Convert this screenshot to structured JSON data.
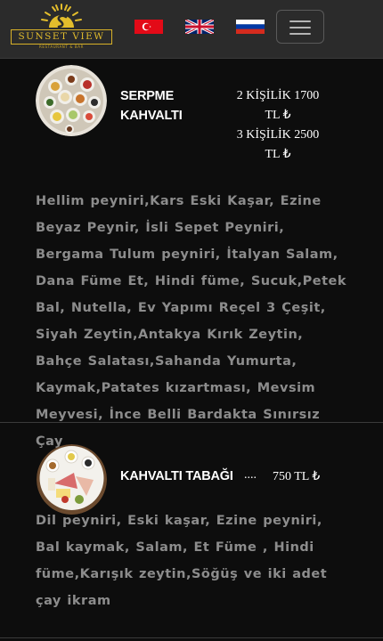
{
  "header": {
    "logo": {
      "title": "SUNSET VIEW",
      "subtitle": "RESTAURANT & BAR"
    },
    "languages": [
      {
        "name": "turkish-flag"
      },
      {
        "name": "english-flag"
      },
      {
        "name": "russian-flag"
      }
    ],
    "menu_icon": "hamburger-icon"
  },
  "colors": {
    "header_bg": "#2b2b2b",
    "page_bg": "#0d0d0d",
    "logo_gold": "#e3bd2c",
    "description_text": "#8c8c8c"
  },
  "items": [
    {
      "name_line1": "SERPME",
      "name_line2": "KAHVALTI",
      "price_line1": "2 KİŞİLİK 1700",
      "price_line2": "TL ₺",
      "price_line3": "3 KİŞİLİK 2500",
      "price_line4": "TL ₺",
      "description": "Hellim peyniri,Kars Eski Kaşar, Ezine Beyaz Peynir, İsli Sepet Peyniri, Bergama Tulum peyniri, İtalyan Salam, Dana Füme Et, Hindi füme, Sucuk,Petek Bal, Nutella, Ev Yapımı Reçel 3 Çeşit, Siyah Zeytin,Antakya Kırık Zeytin, Bahçe Salatası,Sahanda Yumurta, Kaymak,Patates kızartması, Mevsim Meyvesi, İnce Belli Bardakta Sınırsız Çay"
    },
    {
      "name": "KAHVALTI TABAĞI",
      "dots": "....",
      "price": "750 TL ₺",
      "description": "Dil peyniri, Eski kaşar, Ezine peyniri, Bal kaymak, Salam, Et Füme , Hindi füme,Karışık zeytin,Söğüş ve iki adet çay ikram"
    }
  ]
}
